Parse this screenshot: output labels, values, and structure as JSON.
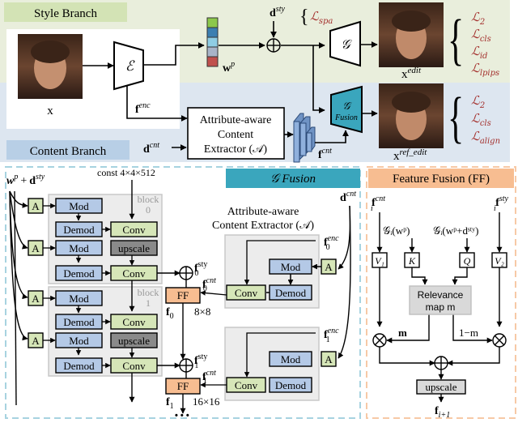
{
  "top": {
    "style_branch_label": "Style Branch",
    "content_branch_label": "Content Branch",
    "input_label": "x",
    "encoder_symbol": "ℰ",
    "f_enc_label": "f",
    "f_enc_sup": "enc",
    "wp_label": "w",
    "wp_sup": "p",
    "d_sty_label": "d",
    "d_sty_sup": "sty",
    "l_spa": "ℒ",
    "l_spa_sub": "spa",
    "generator_symbol": "𝒢",
    "fusion_gen_symbol": "𝒢",
    "fusion_gen_label": "Fusion",
    "extractor_lines": [
      "Attribute-aware",
      "Content",
      "Extractor (𝒜)"
    ],
    "d_cnt_label": "d",
    "d_cnt_sup": "cnt",
    "f_cnt_label": "f",
    "f_cnt_sup": "cnt",
    "x_edit_label": "x",
    "x_edit_sup": "edit",
    "x_ref_edit_label": "x",
    "x_ref_edit_sup": "ref_edit",
    "wp_colors": [
      "#8cc84b",
      "#3c7fb1",
      "#8fcde4",
      "#a8b4c8",
      "#c0504d"
    ],
    "edit_losses": [
      {
        "base": "ℒ",
        "sub": "2"
      },
      {
        "base": "ℒ",
        "sub": "cls"
      },
      {
        "base": "ℒ",
        "sub": "id"
      },
      {
        "base": "ℒ",
        "sub": "lpips"
      }
    ],
    "ref_losses": [
      {
        "base": "ℒ",
        "sub": "2"
      },
      {
        "base": "ℒ",
        "sub": "cls"
      },
      {
        "base": "ℒ",
        "sub": "align"
      }
    ]
  },
  "generator": {
    "input_label": "w",
    "input_sup": "p",
    "input_plus": "+",
    "input_d": "d",
    "input_d_sup": "sty",
    "const_label": "const 4×4×512",
    "a_label": "A",
    "mod_label": "Mod",
    "demod_label": "Demod",
    "conv_label": "Conv",
    "upscale_label": "upscale",
    "block0_label": [
      "block",
      "0"
    ],
    "block1_label": [
      "block",
      "1"
    ]
  },
  "fusion": {
    "title": "𝒢 Fusion",
    "d_cnt": "d",
    "d_cnt_sup": "cnt",
    "extractor_title": [
      "Attribute-aware",
      "Content Extractor (𝒜)"
    ],
    "ff_label": "FF",
    "f0_label": "f",
    "f0_sub": "0",
    "f1_label": "f",
    "f1_sub": "1",
    "size0": "8×8",
    "size1": "16×16",
    "ellipsis": "• • •",
    "enc_sup": "enc",
    "sty_sup": "sty",
    "cnt_sup": "cnt"
  },
  "ff": {
    "title": "Feature Fusion (FF)",
    "f_cnt": "f",
    "f_cnt_sup": "cnt",
    "f_sty": "f",
    "f_sty_sup": "sty",
    "sub_i": "i",
    "g_wp": "𝒢ᵢ(wᵖ)",
    "g_wp_d": "𝒢ᵢ(wᵖ+dˢᵗʸ)",
    "v1": "V₁",
    "k": "K",
    "q": "Q",
    "v2": "V₂",
    "relevance": [
      "Relevance",
      "map m"
    ],
    "m_label": "m",
    "one_minus_m": "1−m",
    "upscale": "upscale",
    "out": "f",
    "out_sub": "i+1"
  },
  "colors": {
    "style_bg": "#e9eedc",
    "content_bg": "#dde6f0",
    "style_tag": "#d3e3b5",
    "content_tag": "#b8cfe6",
    "fusion_teal": "#3aa6bd",
    "ff_orange": "#f7bd91",
    "mod_blue": "#b4c9e6",
    "conv_green": "#d6e6b8",
    "upscale_gray": "#8a8a8a",
    "block_gray": "#ececec",
    "loss_red": "#a4322f"
  }
}
